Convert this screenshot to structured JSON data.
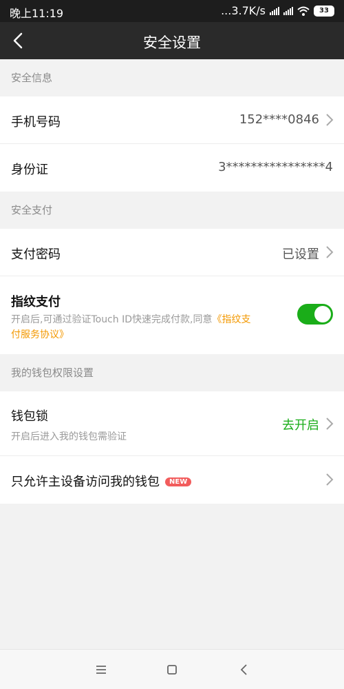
{
  "status_bar": {
    "time": "晚上11:19",
    "network_speed": "...3.7K/s",
    "battery_level": "33",
    "icons": [
      "signal-icon",
      "signal-icon",
      "wifi-icon",
      "battery-icon"
    ]
  },
  "header": {
    "title": "安全设置",
    "back_icon": "back-arrow-icon"
  },
  "sections": {
    "security_info": {
      "title": "安全信息",
      "phone": {
        "label": "手机号码",
        "value": "152****0846"
      },
      "id_card": {
        "label": "身份证",
        "value": "3****************4"
      }
    },
    "security_payment": {
      "title": "安全支付",
      "pay_password": {
        "label": "支付密码",
        "value": "已设置"
      },
      "fingerprint": {
        "label": "指纹支付",
        "desc_text": "开启后,可通过验证Touch ID快速完成付款,同意",
        "desc_link": "《指纹支付服务协议》",
        "enabled": true
      }
    },
    "wallet_permissions": {
      "title": "我的钱包权限设置",
      "wallet_lock": {
        "label": "钱包锁",
        "sub": "开启后进入我的钱包需验证",
        "action": "去开启"
      },
      "primary_device": {
        "label": "只允许主设备访问我的钱包",
        "badge": "NEW"
      }
    }
  },
  "colors": {
    "accent_green": "#1aad19",
    "link_orange": "#f39800",
    "badge_red": "#f25c5c",
    "header_bg": "#2a2a2a"
  },
  "system_nav": {
    "icons": [
      "menu-icon",
      "home-icon",
      "back-icon"
    ]
  }
}
